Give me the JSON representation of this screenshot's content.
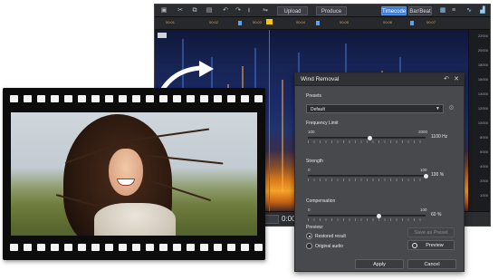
{
  "toolbar": {
    "upload_label": "Upload",
    "produce_label": "Produce",
    "timecode_label": "Timecode",
    "barbeat_label": "Bar/Beat",
    "icons": [
      "save-icon",
      "cut-icon",
      "copy-icon",
      "paste-icon",
      "undo-icon",
      "redo-icon",
      "download-icon",
      "transport-icon"
    ]
  },
  "ruler": {
    "ticks": [
      "00:01",
      "00:02",
      "00:03",
      "00:04",
      "00:05",
      "00:06",
      "00:07"
    ]
  },
  "frequency_scale": [
    "22000",
    "20000",
    "18000",
    "16000",
    "14000",
    "12000",
    "10000",
    "8000",
    "6000",
    "4000",
    "2000",
    "1000"
  ],
  "status_bar": {
    "time": "0:00"
  },
  "dialog": {
    "title": "Wind Removal",
    "presets_label": "Presets",
    "preset_value": "Default",
    "frequency_limit": {
      "label": "Frequency Limit",
      "min": "100",
      "max": "2000",
      "value": "1100 Hz",
      "level": 0.53
    },
    "strength": {
      "label": "Strength",
      "min": "0",
      "max": "100",
      "value": "100 %",
      "level": 1.0
    },
    "compensation": {
      "label": "Compensation",
      "min": "0",
      "max": "100",
      "value": "60 %",
      "level": 0.6
    },
    "preview": {
      "label": "Preview:",
      "option_restored": "Restored result",
      "option_original": "Original audio",
      "save_preset_label": "Save as Preset",
      "preview_button_label": "Preview"
    },
    "apply_label": "Apply",
    "cancel_label": "Cancel"
  },
  "colors": {
    "dialog_bg": "#47494d",
    "accent": "#3f7fd8",
    "playhead": "#e23a2a",
    "marker": "#f5c518"
  }
}
